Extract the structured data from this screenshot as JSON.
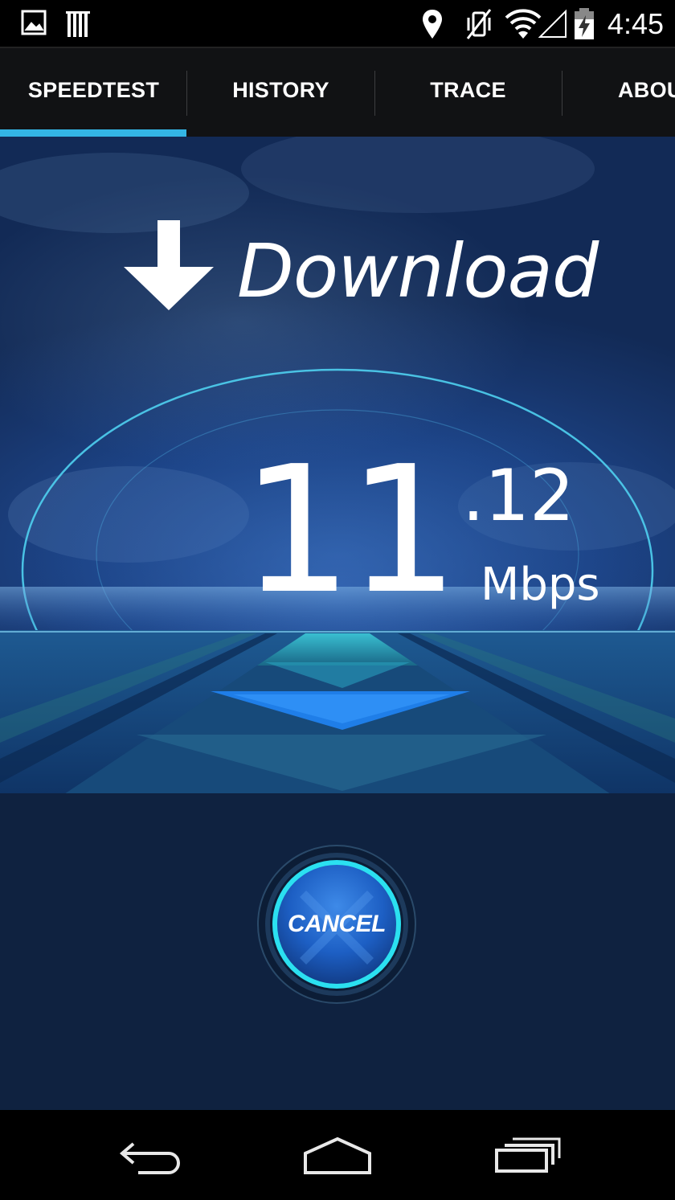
{
  "status_bar": {
    "time": "4:45",
    "icons": [
      "image-notification-icon",
      "barcode-notification-icon",
      "location-icon",
      "vibrate-off-icon",
      "wifi-icon",
      "signal-icon",
      "battery-charging-icon"
    ]
  },
  "tabs": [
    {
      "label": "SPEEDTEST",
      "selected": true
    },
    {
      "label": "HISTORY",
      "selected": false
    },
    {
      "label": "TRACE",
      "selected": false
    },
    {
      "label": "ABOU",
      "selected": false
    }
  ],
  "test": {
    "phase": "Download",
    "speed_integer": "11",
    "speed_decimal": ".12",
    "unit": "Mbps"
  },
  "cancel_button": {
    "label": "CANCEL"
  },
  "navigation": {
    "icons": [
      "back-icon",
      "home-icon",
      "recent-apps-icon"
    ]
  },
  "colors": {
    "accent": "#33b5e5",
    "background": "#0f2240"
  }
}
